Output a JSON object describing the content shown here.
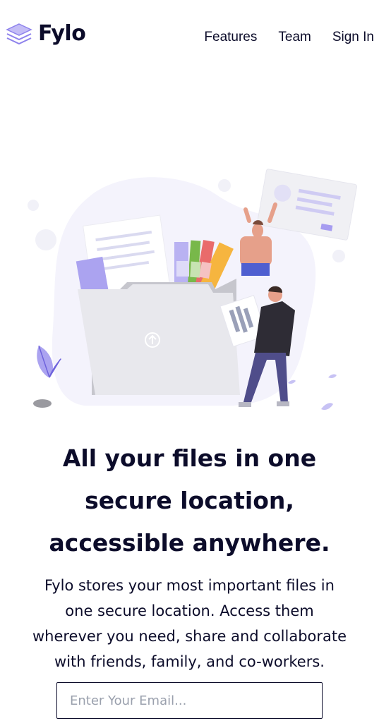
{
  "header": {
    "logo_text": "Fylo",
    "logo_icon": "stacked-layers-icon",
    "nav": [
      {
        "label": "Features"
      },
      {
        "label": "Team"
      },
      {
        "label": "Sign In"
      }
    ]
  },
  "hero": {
    "illustration": "people-with-files-and-folder-illustration",
    "headline_lines": [
      "All your files in one",
      "secure location,",
      "accessible anywhere."
    ],
    "description_lines": [
      "Fylo stores your most important files in",
      "one secure location. Access them",
      "wherever you need, share and collaborate",
      "with friends, family, and co-workers."
    ]
  },
  "signup": {
    "email_placeholder": "Enter Your Email..."
  },
  "colors": {
    "text": "#0c0c2a",
    "accent": "#7c6cf0",
    "placeholder": "#9aa0ad"
  }
}
